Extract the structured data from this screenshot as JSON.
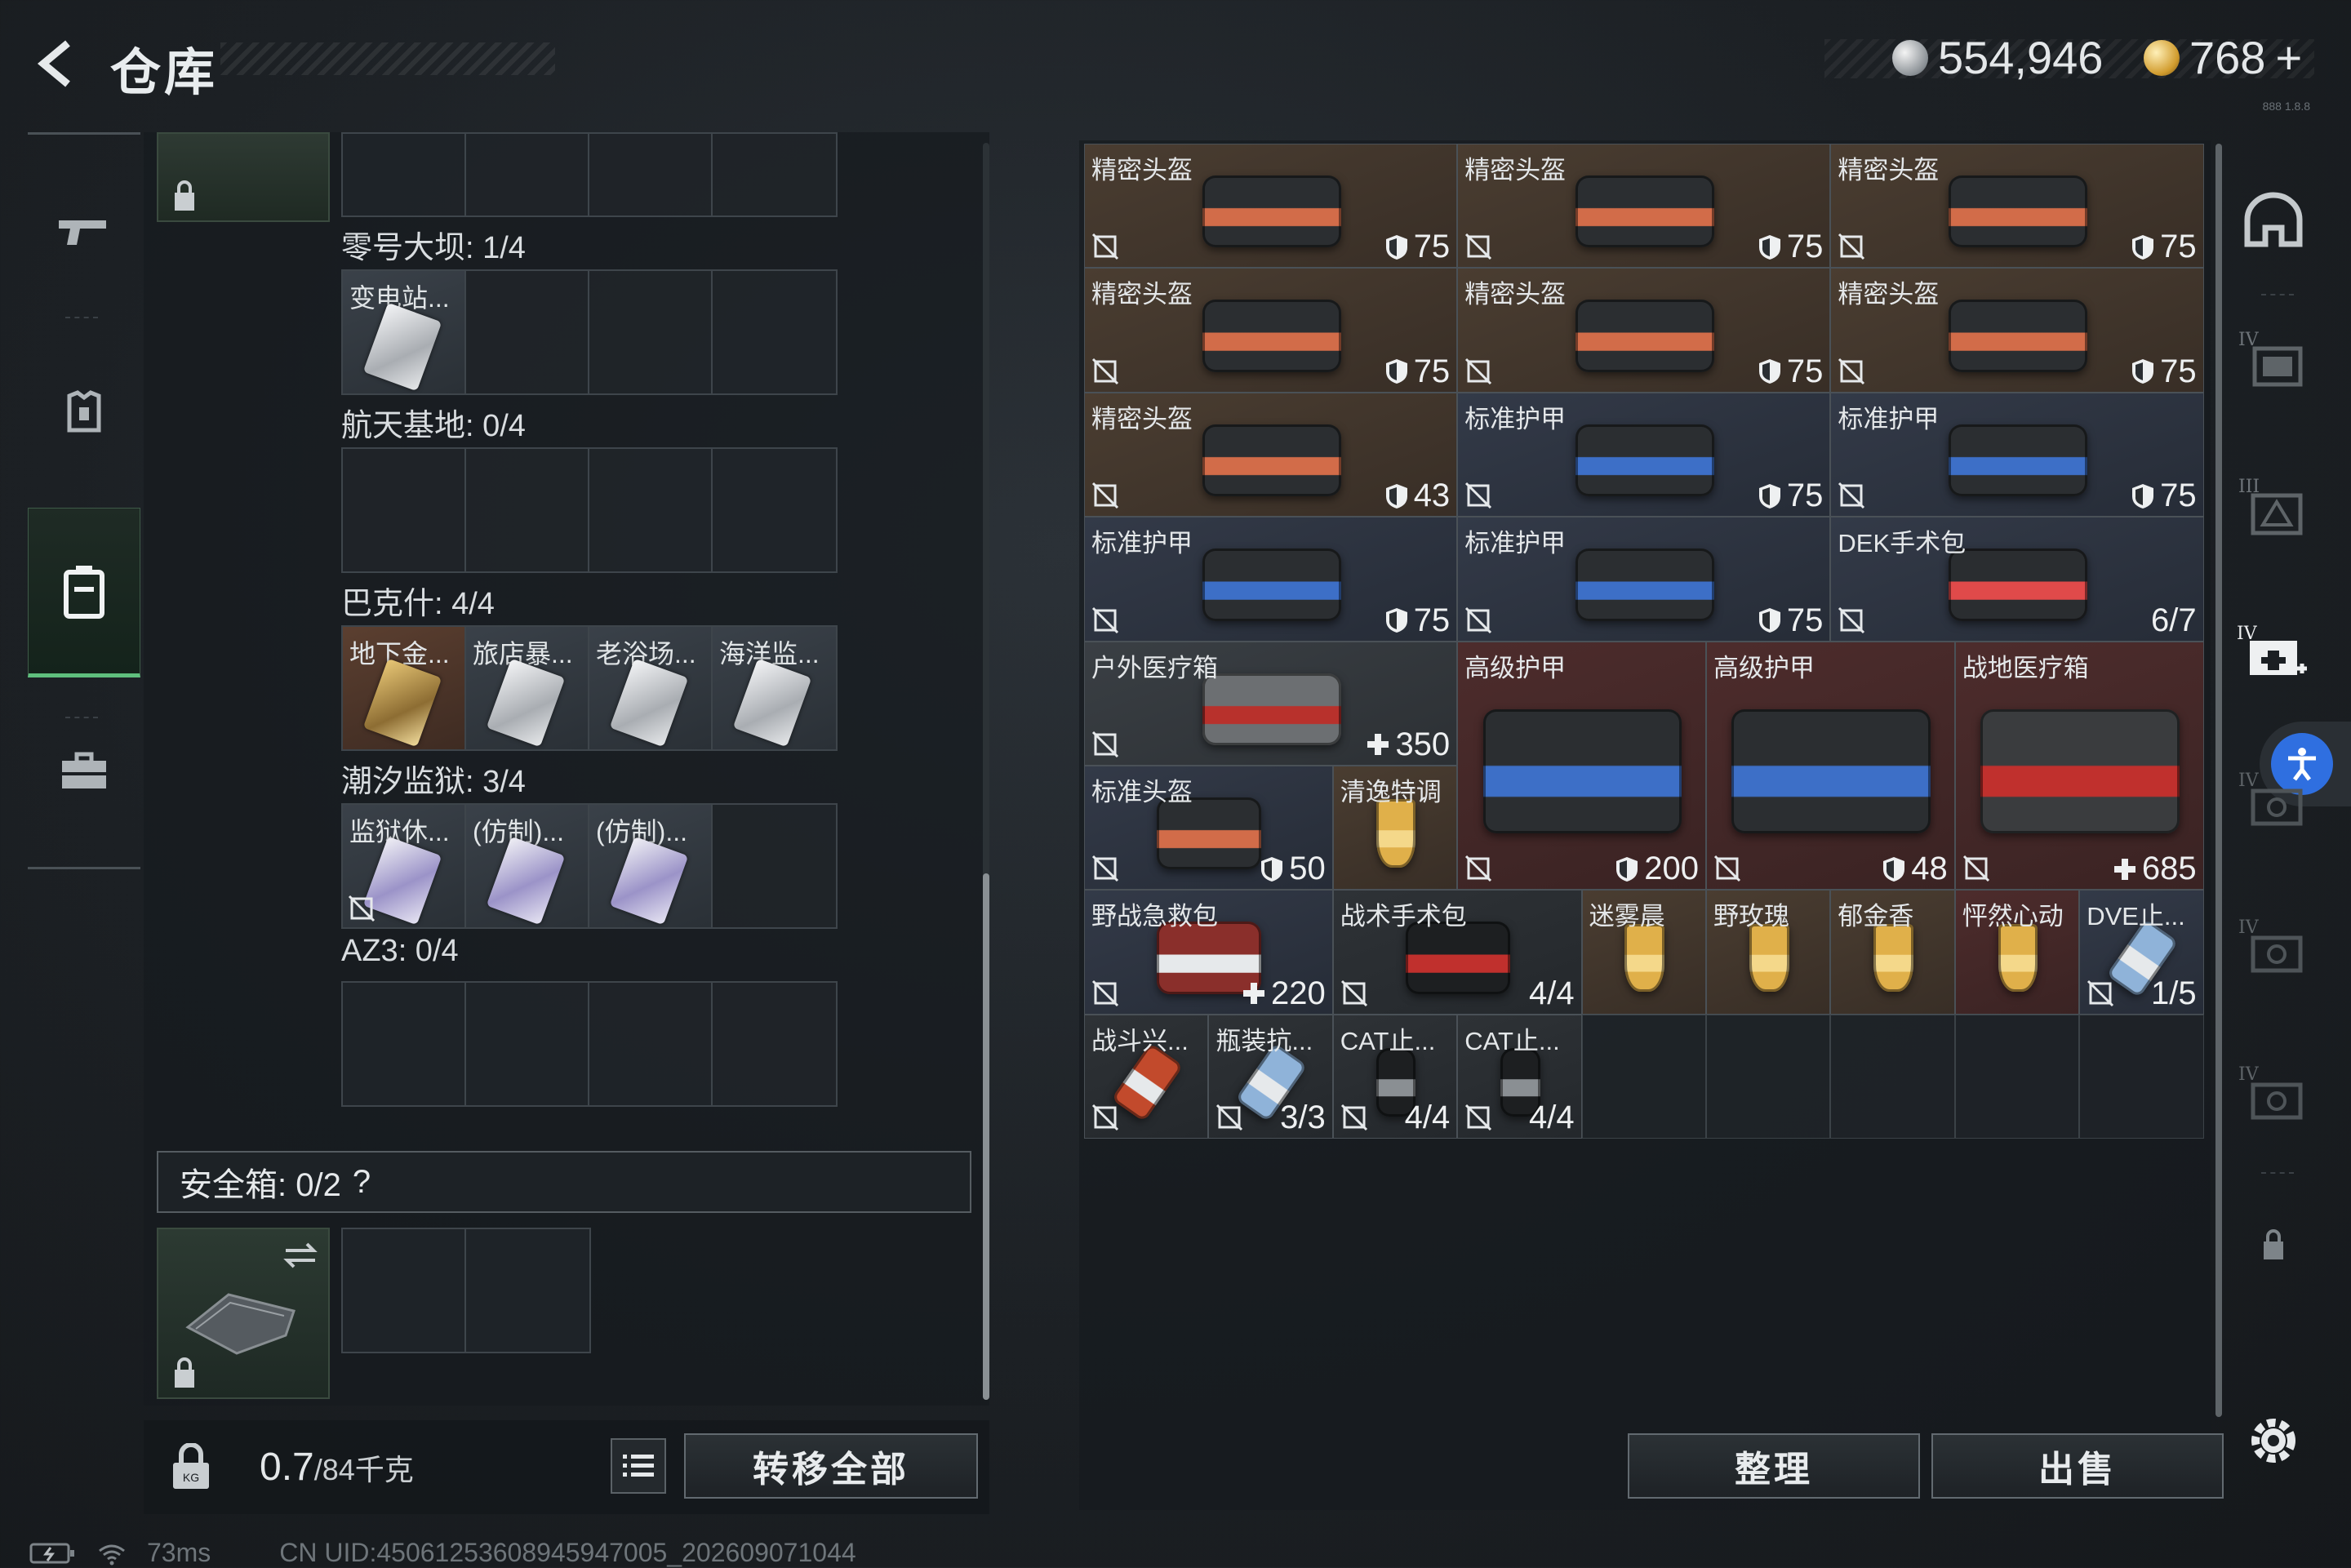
{
  "header": {
    "title": "仓库",
    "coins": "554,946",
    "gold": "768",
    "gold_plus": "+",
    "build": "888 1.8.8"
  },
  "left": {
    "sections": [
      {
        "label": "零号大坝: 1/4",
        "items": [
          "变电站..."
        ]
      },
      {
        "label": "航天基地: 0/4",
        "items": []
      },
      {
        "label": "巴克什: 4/4",
        "items": [
          "地下金...",
          "旅店暴...",
          "老浴场...",
          "海洋监..."
        ]
      },
      {
        "label": "潮汐监狱: 3/4",
        "items": [
          "监狱休...",
          "(仿制)...",
          "(仿制)..."
        ]
      },
      {
        "label": "AZ3: 0/4",
        "items": []
      }
    ],
    "safe_box": {
      "label": "安全箱: 0/2",
      "help": "?"
    },
    "weight": {
      "current": "0.7",
      "max": "/84千克"
    },
    "transfer_all": "转移全部"
  },
  "inventory": [
    {
      "name": "精密头盔",
      "value": "75",
      "kind": "shield"
    },
    {
      "name": "精密头盔",
      "value": "75",
      "kind": "shield"
    },
    {
      "name": "精密头盔",
      "value": "75",
      "kind": "shield"
    },
    {
      "name": "精密头盔",
      "value": "75",
      "kind": "shield"
    },
    {
      "name": "精密头盔",
      "value": "75",
      "kind": "shield"
    },
    {
      "name": "精密头盔",
      "value": "75",
      "kind": "shield"
    },
    {
      "name": "精密头盔",
      "value": "43",
      "kind": "shield"
    },
    {
      "name": "标准护甲",
      "value": "75",
      "kind": "shield"
    },
    {
      "name": "标准护甲",
      "value": "75",
      "kind": "shield"
    },
    {
      "name": "标准护甲",
      "value": "75",
      "kind": "shield"
    },
    {
      "name": "标准护甲",
      "value": "75",
      "kind": "shield"
    },
    {
      "name": "DEK手术包",
      "value": "6/7",
      "kind": "count"
    },
    {
      "name": "户外医疗箱",
      "value": "350",
      "kind": "heal"
    },
    {
      "name": "高级护甲",
      "value": "200",
      "kind": "shield"
    },
    {
      "name": "高级护甲",
      "value": "48",
      "kind": "shield"
    },
    {
      "name": "战地医疗箱",
      "value": "685",
      "kind": "heal"
    },
    {
      "name": "标准头盔",
      "value": "50",
      "kind": "shield"
    },
    {
      "name": "清逸特调",
      "value": "",
      "kind": "none"
    },
    {
      "name": "野战急救包",
      "value": "220",
      "kind": "heal"
    },
    {
      "name": "战术手术包",
      "value": "4/4",
      "kind": "count"
    },
    {
      "name": "迷雾晨",
      "value": "",
      "kind": "none"
    },
    {
      "name": "野玫瑰",
      "value": "",
      "kind": "none"
    },
    {
      "name": "郁金香",
      "value": "",
      "kind": "none"
    },
    {
      "name": "怦然心动",
      "value": "",
      "kind": "none"
    },
    {
      "name": "DVE止...",
      "value": "1/5",
      "kind": "count"
    },
    {
      "name": "战斗兴...",
      "value": "",
      "kind": "none"
    },
    {
      "name": "瓶装抗...",
      "value": "3/3",
      "kind": "count"
    },
    {
      "name": "CAT止...",
      "value": "4/4",
      "kind": "count"
    },
    {
      "name": "CAT止...",
      "value": "4/4",
      "kind": "count"
    }
  ],
  "buttons": {
    "sort": "整理",
    "sell": "出售"
  },
  "status": {
    "ping": "73ms",
    "uid": "CN UID:4506125360894594700​5_202609071044"
  },
  "colors": {
    "accent_green": "#5fbf7d",
    "accessibility_blue": "#2f6fe0"
  }
}
